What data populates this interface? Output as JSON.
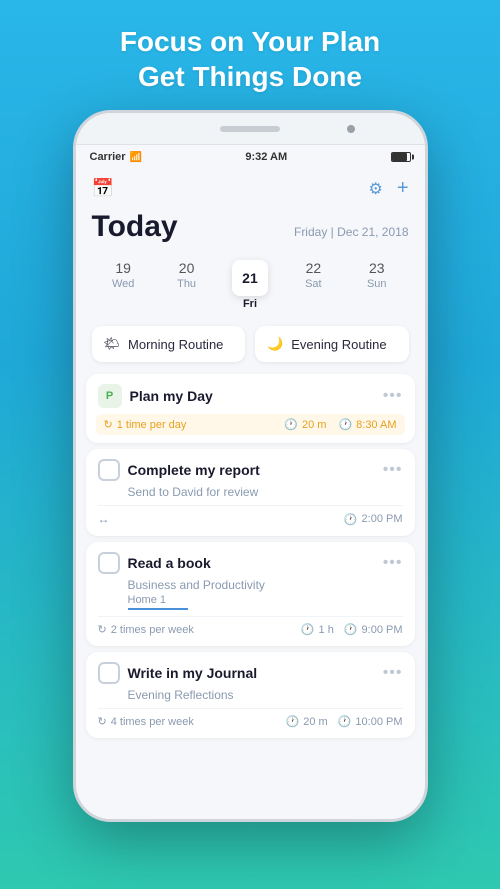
{
  "hero": {
    "line1": "Focus on Your Plan",
    "line2": "Get Things Done"
  },
  "statusBar": {
    "carrier": "Carrier",
    "time": "9:32 AM"
  },
  "toolbar": {
    "calendarIcon": "📅",
    "filterIcon": "⚙",
    "addIcon": "+"
  },
  "header": {
    "title": "Today",
    "dateLabel": "Friday | Dec 21, 2018"
  },
  "calendarStrip": [
    {
      "num": "19",
      "name": "Wed",
      "active": false
    },
    {
      "num": "20",
      "name": "Thu",
      "active": false
    },
    {
      "num": "21",
      "name": "Fri",
      "active": true
    },
    {
      "num": "22",
      "name": "Sat",
      "active": false
    },
    {
      "num": "23",
      "name": "Sun",
      "active": false
    }
  ],
  "routines": [
    {
      "icon": "🌤",
      "label": "Morning Routine"
    },
    {
      "icon": "🌙",
      "label": "Evening Routine"
    }
  ],
  "tasks": [
    {
      "id": "plan-my-day",
      "iconType": "p",
      "title": "Plan my Day",
      "subtitle": null,
      "tag": null,
      "frequency": "1 time per day",
      "duration": "20 m",
      "time": "8:30 AM",
      "highlightFooter": true
    },
    {
      "id": "complete-report",
      "iconType": "checkbox",
      "title": "Complete my report",
      "subtitle": "Send to David for review",
      "tag": null,
      "frequency": null,
      "duration": null,
      "time": "2:00 PM",
      "highlightFooter": false
    },
    {
      "id": "read-book",
      "iconType": "checkbox",
      "title": "Read a book",
      "subtitle": "Business and Productivity",
      "tag": "Home 1",
      "frequency": "2 times per week",
      "duration": "1 h",
      "time": "9:00 PM",
      "highlightFooter": false
    },
    {
      "id": "write-journal",
      "iconType": "checkbox",
      "title": "Write in my Journal",
      "subtitle": "Evening Reflections",
      "tag": null,
      "frequency": "4 times per week",
      "duration": "20 m",
      "time": "10:00 PM",
      "highlightFooter": false
    }
  ]
}
